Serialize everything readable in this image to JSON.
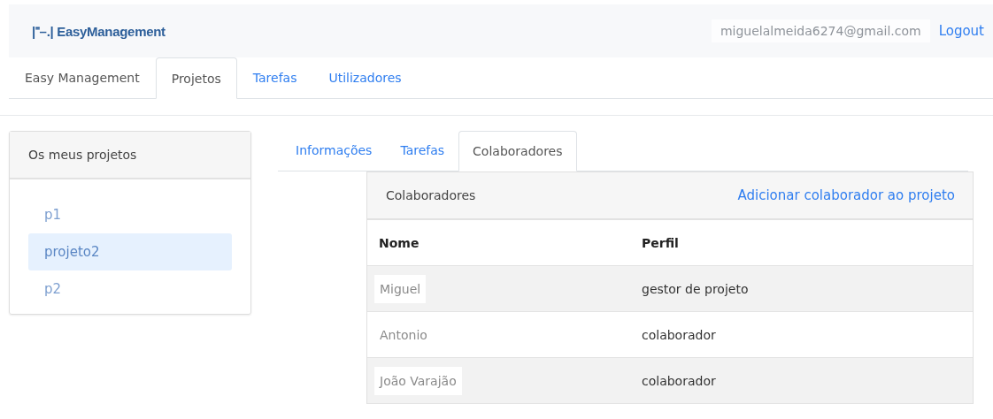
{
  "header": {
    "logo": "|⁼–.| EasyManagement",
    "email": "miguelalmeida6274@gmail.com",
    "logout": "Logout"
  },
  "nav_tabs": [
    {
      "label": "Easy Management",
      "selected": false,
      "kind": "brand"
    },
    {
      "label": "Projetos",
      "selected": true,
      "kind": "link"
    },
    {
      "label": "Tarefas",
      "selected": false,
      "kind": "link"
    },
    {
      "label": "Utilizadores",
      "selected": false,
      "kind": "link"
    }
  ],
  "projects": {
    "title": "Os meus projetos",
    "items": [
      {
        "label": "p1",
        "selected": false
      },
      {
        "label": "projeto2",
        "selected": true
      },
      {
        "label": "p2",
        "selected": false
      }
    ]
  },
  "project_tabs": [
    {
      "label": "Informações",
      "selected": false
    },
    {
      "label": "Tarefas",
      "selected": false
    },
    {
      "label": "Colaboradores",
      "selected": true
    }
  ],
  "collaborators": {
    "title": "Colaboradores",
    "add_link": "Adicionar colaborador ao projeto",
    "columns": [
      "Nome",
      "Perfil"
    ],
    "rows": [
      {
        "name": "Miguel",
        "profile": "gestor de projeto"
      },
      {
        "name": "Antonio",
        "profile": "colaborador"
      },
      {
        "name": "João Varajão",
        "profile": "colaborador"
      }
    ]
  }
}
